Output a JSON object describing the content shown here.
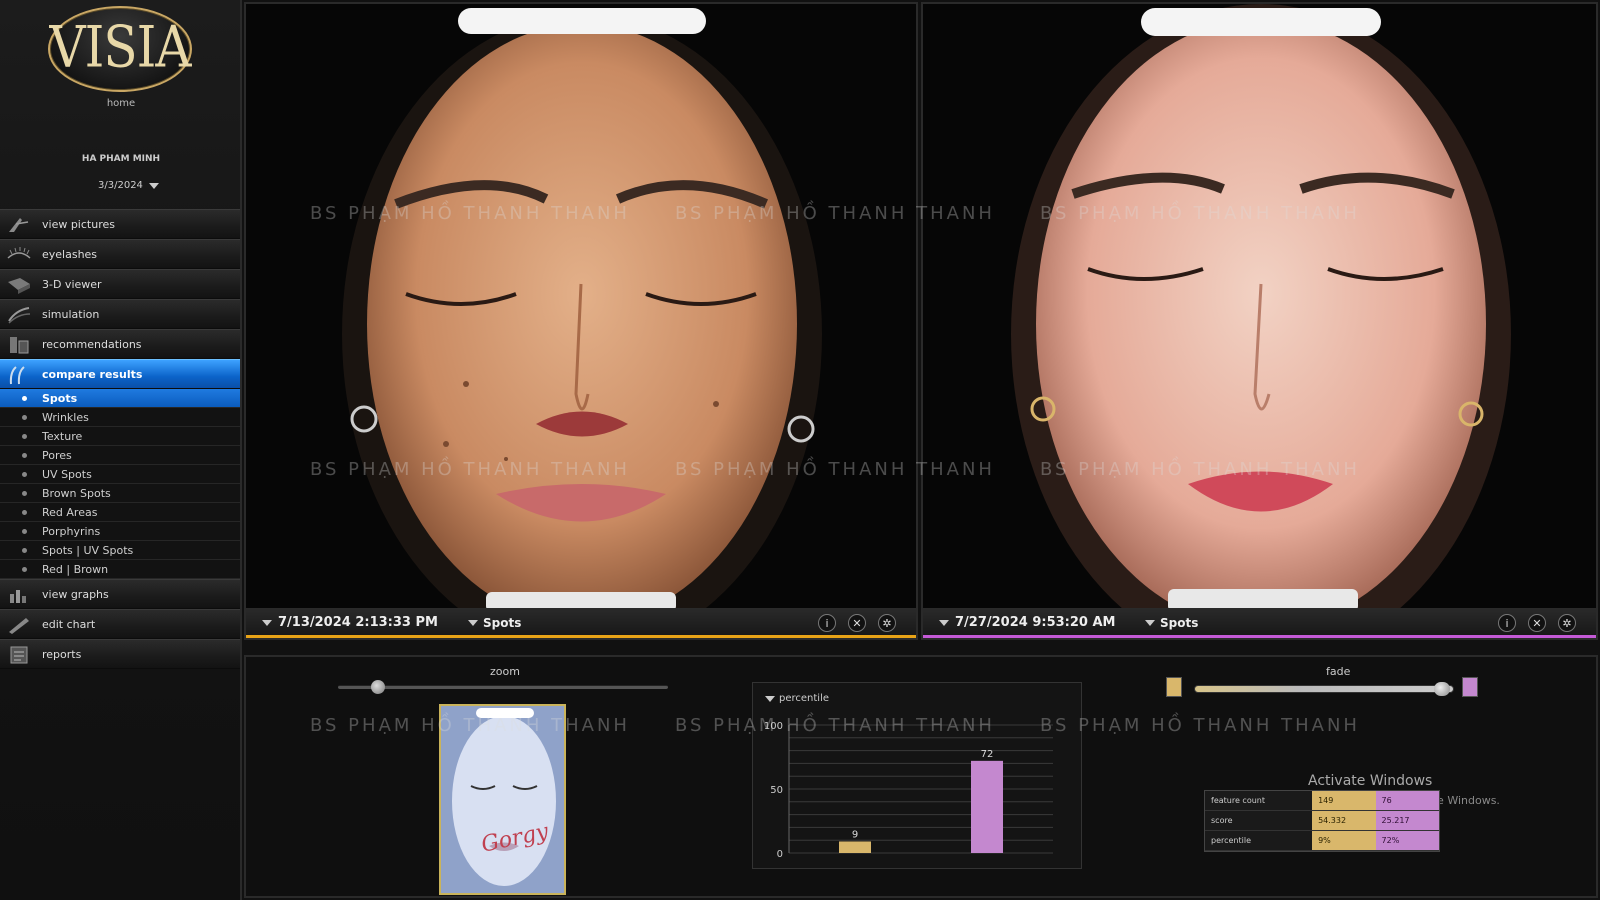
{
  "app": {
    "logo_text": "VISIA",
    "home_label": "home"
  },
  "patient": {
    "name": "HA PHAM MINH",
    "date": "3/3/2024"
  },
  "nav": {
    "items": [
      {
        "label": "view pictures"
      },
      {
        "label": "eyelashes"
      },
      {
        "label": "3-D viewer"
      },
      {
        "label": "simulation"
      },
      {
        "label": "recommendations"
      },
      {
        "label": "compare results"
      }
    ],
    "sub_items": [
      {
        "label": "Spots"
      },
      {
        "label": "Wrinkles"
      },
      {
        "label": "Texture"
      },
      {
        "label": "Pores"
      },
      {
        "label": "UV Spots"
      },
      {
        "label": "Brown Spots"
      },
      {
        "label": "Red Areas"
      },
      {
        "label": "Porphyrins"
      },
      {
        "label": "Spots | UV Spots"
      },
      {
        "label": "Red | Brown"
      }
    ],
    "bottom_items": [
      {
        "label": "view graphs"
      },
      {
        "label": "edit chart"
      },
      {
        "label": "reports"
      }
    ]
  },
  "left_panel": {
    "date": "7/13/2024 2:13:33 PM",
    "layer": "Spots",
    "accent": "#e8a317"
  },
  "right_panel": {
    "date": "7/27/2024 9:53:20 AM",
    "layer": "Spots",
    "accent": "#c45ad6"
  },
  "watermark": {
    "text": "BS PHẠM HỒ THANH THANH"
  },
  "controls": {
    "zoom_label": "zoom",
    "zoom_level": 0.12,
    "fade_label": "fade",
    "fade_level": 0.95,
    "thumbnail_signature": "Gorgy"
  },
  "chart_data": {
    "type": "bar",
    "title": "percentile",
    "categories": [
      "7/13/2024 2:13:33 PM",
      "7/27/2024 9:53:20 AM"
    ],
    "values": [
      9,
      72
    ],
    "colors": [
      "#d9b76b",
      "#c488cf"
    ],
    "ylim": [
      0,
      100
    ],
    "yticks": [
      0,
      50,
      100
    ]
  },
  "stats": {
    "rows": [
      {
        "label": "feature count",
        "v1": "149",
        "v2": "76"
      },
      {
        "label": "score",
        "v1": "54.332",
        "v2": "25.217"
      },
      {
        "label": "percentile",
        "v1": "9%",
        "v2": "72%"
      }
    ]
  },
  "os_overlay": {
    "title": "Activate Windows",
    "subtitle": "ate Windows."
  }
}
